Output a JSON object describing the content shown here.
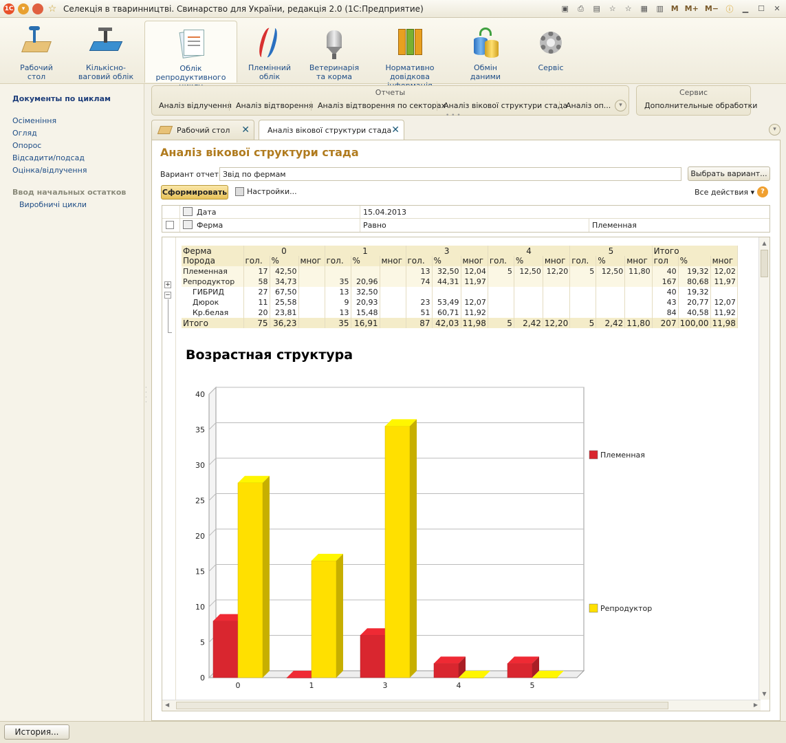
{
  "window": {
    "title": "Селекція в тваринництві. Свинарство для України, редакція 2.0  (1С:Предприятие)",
    "mem_buttons": [
      "M",
      "M+",
      "M−"
    ]
  },
  "sections": [
    {
      "label": "Рабочий стол",
      "icon": "desk-icon"
    },
    {
      "label": "Кількісно-ваговий облік",
      "icon": "scales-icon"
    },
    {
      "label": "Облік репродуктивного циклу",
      "icon": "documents-icon"
    },
    {
      "label": "Племінний облік",
      "icon": "dna-icon"
    },
    {
      "label": "Ветеринарія та корма",
      "icon": "silo-icon"
    },
    {
      "label": "Нормативно довідкова інформація",
      "icon": "binders-icon"
    },
    {
      "label": "Обмін даними",
      "icon": "database-exchange-icon"
    },
    {
      "label": "Сервіс",
      "icon": "gear-icon"
    }
  ],
  "left_panel": {
    "header": "Документы по циклам",
    "items": [
      "Осіменіння",
      "Огляд",
      "Опорос",
      "Відсадити/подсад",
      "Оцінка/відлучення"
    ],
    "group": "Ввод начальных остатков",
    "sub_items": [
      "Виробничі цикли"
    ]
  },
  "reports_group": {
    "title": "Отчеты",
    "items": [
      "Аналіз відлучення",
      "Аналіз відтворення",
      "Аналіз відтворення по секторах",
      "Аналіз вікової структури стада",
      "Аналіз оп..."
    ]
  },
  "service_group": {
    "title": "Сервис",
    "items": [
      "Дополнительные обработки"
    ]
  },
  "tabs": [
    {
      "label": "Рабочий стол"
    },
    {
      "label": "Аналіз вікової структури стада"
    }
  ],
  "form": {
    "title": "Аналіз вікової структури стада",
    "variant_label": "Вариант отчета:",
    "variant_value": "Звід по фермам",
    "choose_variant": "Выбрать вариант...",
    "generate": "Сформировать",
    "settings": "Настройки...",
    "all_actions": "Все действия",
    "help": "?"
  },
  "params": [
    {
      "name": "Дата",
      "cond": "15.04.2013",
      "value": ""
    },
    {
      "name": "Ферма",
      "cond": "Равно",
      "value": "Племенная"
    }
  ],
  "report": {
    "header_row1": [
      "Ферма",
      "0",
      "1",
      "3",
      "4",
      "5",
      "Итого"
    ],
    "header_row2_first": "Порода",
    "sub_cols": [
      "гол.",
      "%",
      "мног",
      "гол.",
      "%",
      "мног",
      "гол.",
      "%",
      "мног",
      "гол.",
      "%",
      "мног",
      "гол.",
      "%",
      "мног",
      "гол",
      "%",
      "мног"
    ],
    "rows": [
      {
        "label": "Племенная",
        "kind": "group",
        "sign": "+",
        "cells": [
          "17",
          "42,50",
          "",
          "",
          "",
          "",
          "13",
          "32,50",
          "12,04",
          "5",
          "12,50",
          "12,20",
          "5",
          "12,50",
          "11,80",
          "40",
          "19,32",
          "12,02"
        ]
      },
      {
        "label": "Репродуктор",
        "kind": "group",
        "sign": "−",
        "cells": [
          "58",
          "34,73",
          "",
          "35",
          "20,96",
          "",
          "74",
          "44,31",
          "11,97",
          "",
          "",
          "",
          "",
          "",
          "",
          "167",
          "80,68",
          "11,97"
        ]
      },
      {
        "label": "ГИБРИД",
        "kind": "sub",
        "cells": [
          "27",
          "67,50",
          "",
          "13",
          "32,50",
          "",
          "",
          "",
          "",
          "",
          "",
          "",
          "",
          "",
          "",
          "40",
          "19,32",
          ""
        ]
      },
      {
        "label": "Дюрок",
        "kind": "sub",
        "cells": [
          "11",
          "25,58",
          "",
          "9",
          "20,93",
          "",
          "23",
          "53,49",
          "12,07",
          "",
          "",
          "",
          "",
          "",
          "",
          "43",
          "20,77",
          "12,07"
        ]
      },
      {
        "label": "Кр.белая",
        "kind": "sub",
        "cells": [
          "20",
          "23,81",
          "",
          "13",
          "15,48",
          "",
          "51",
          "60,71",
          "11,92",
          "",
          "",
          "",
          "",
          "",
          "",
          "84",
          "40,58",
          "11,92"
        ]
      },
      {
        "label": "Итого",
        "kind": "total",
        "cells": [
          "75",
          "36,23",
          "",
          "35",
          "16,91",
          "",
          "87",
          "42,03",
          "11,98",
          "5",
          "2,42",
          "12,20",
          "5",
          "2,42",
          "11,80",
          "207",
          "100,00",
          "11,98"
        ]
      }
    ]
  },
  "chart_data": {
    "type": "bar",
    "title": "Возрастная структура",
    "categories": [
      "0",
      "1",
      "3",
      "4",
      "5"
    ],
    "series": [
      {
        "name": "Племенная",
        "values": [
          8,
          0,
          6,
          2,
          2
        ],
        "color": "#d9262f"
      },
      {
        "name": "Репродуктор",
        "values": [
          27.5,
          16.5,
          35.5,
          0,
          0
        ],
        "color": "#ffe000"
      }
    ],
    "ylim": [
      0,
      40
    ],
    "yticks": [
      "0",
      "5",
      "10",
      "15",
      "20",
      "25",
      "30",
      "35",
      "40"
    ],
    "legend_position": "right",
    "grid": true
  },
  "footer": {
    "history": "История..."
  }
}
